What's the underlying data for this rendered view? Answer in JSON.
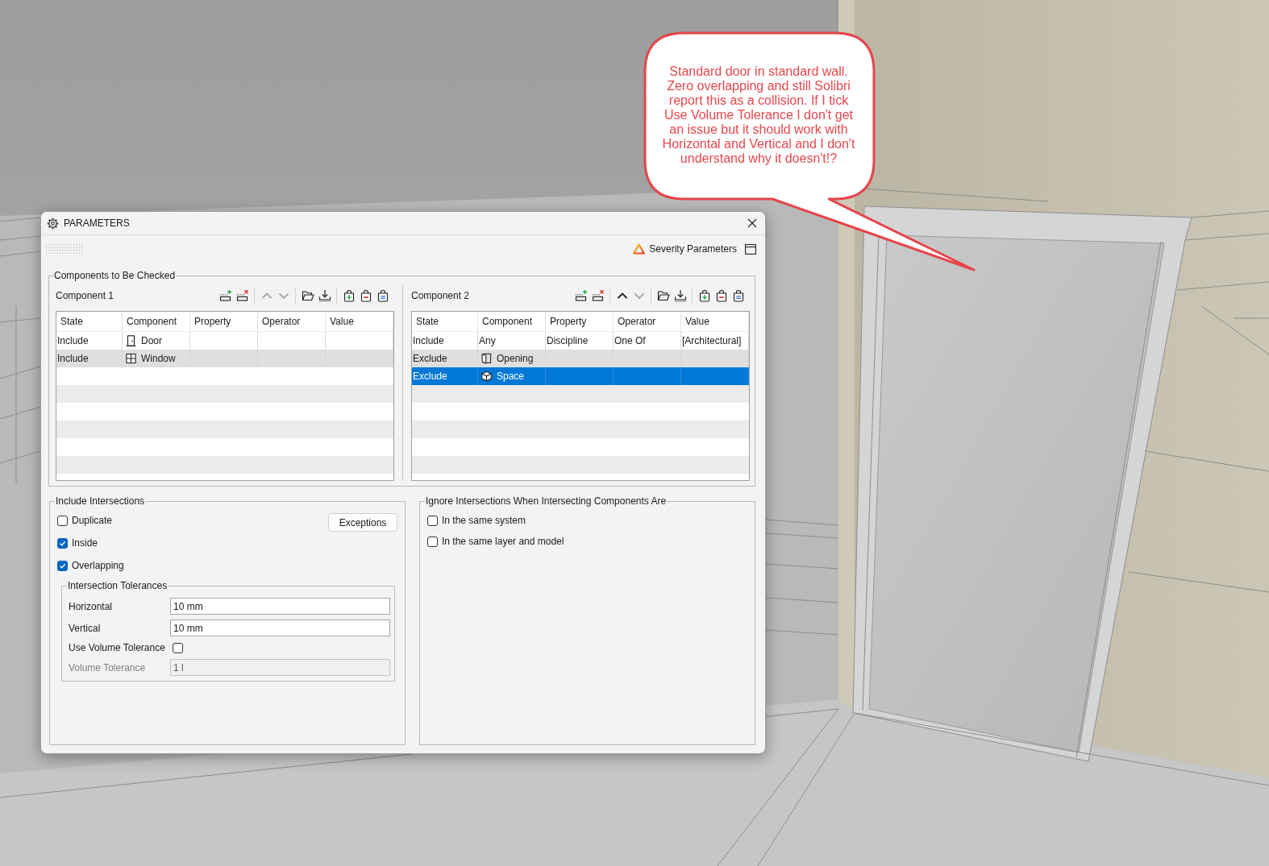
{
  "window": {
    "title": "PARAMETERS"
  },
  "header": {
    "severity_button": "Severity Parameters"
  },
  "components_group": {
    "title": "Components to Be Checked",
    "panels": [
      {
        "title": "Component 1",
        "toolbar": [
          [
            {
              "kind": "add_row",
              "disabled": false
            },
            {
              "kind": "remove_row",
              "disabled": false
            }
          ],
          [
            {
              "kind": "move_up",
              "disabled": true
            },
            {
              "kind": "move_down",
              "disabled": true
            }
          ],
          [
            {
              "kind": "open",
              "disabled": false
            },
            {
              "kind": "import",
              "disabled": false
            }
          ],
          [
            {
              "kind": "bag_add",
              "disabled": false
            },
            {
              "kind": "bag_remove",
              "disabled": false
            },
            {
              "kind": "bag_edit",
              "disabled": false
            }
          ]
        ],
        "table": {
          "columns": [
            "State",
            "Component",
            "Property",
            "Operator",
            "Value"
          ],
          "rows": [
            {
              "kind": "door",
              "selected": false,
              "state": "Include",
              "component": "Door"
            },
            {
              "kind": "window",
              "selected": false,
              "state": "Include",
              "component": "Window"
            }
          ]
        }
      },
      {
        "title": "Component 2",
        "toolbar": [
          [
            {
              "kind": "add_row",
              "disabled": false
            },
            {
              "kind": "remove_row",
              "disabled": false
            }
          ],
          [
            {
              "kind": "move_up",
              "disabled": false
            },
            {
              "kind": "move_down",
              "disabled": true
            }
          ],
          [
            {
              "kind": "open",
              "disabled": false
            },
            {
              "kind": "import",
              "disabled": false
            }
          ],
          [
            {
              "kind": "bag_add",
              "disabled": false
            },
            {
              "kind": "bag_remove",
              "disabled": false
            },
            {
              "kind": "bag_edit",
              "disabled": false
            }
          ]
        ],
        "table": {
          "columns": [
            "State",
            "Component",
            "Property",
            "Operator",
            "Value"
          ],
          "rows": [
            {
              "kind": "plain",
              "selected": false,
              "state": "Include",
              "component": "Any",
              "property": "Discipline",
              "operator": "One Of",
              "value": "[Architectural]"
            },
            {
              "kind": "opening",
              "selected": false,
              "state": "Exclude",
              "component": "Opening"
            },
            {
              "kind": "space",
              "selected": true,
              "state": "Exclude",
              "component": "Space"
            }
          ]
        }
      }
    ]
  },
  "include_intersections": {
    "title": "Include Intersections",
    "options": [
      {
        "label": "Duplicate",
        "checked": false
      },
      {
        "label": "Inside",
        "checked": true
      },
      {
        "label": "Overlapping",
        "checked": true
      }
    ],
    "exceptions_button": "Exceptions",
    "tolerances": {
      "title": "Intersection Tolerances",
      "fields": [
        {
          "kind": "text",
          "label": "Horizontal",
          "value": "10 mm",
          "disabled": false
        },
        {
          "kind": "text",
          "label": "Vertical",
          "value": "10 mm",
          "disabled": false
        },
        {
          "kind": "checkbox",
          "label": "Use Volume Tolerance",
          "checked": false
        },
        {
          "kind": "text",
          "label": "Volume Tolerance",
          "value": "1 l",
          "disabled": true
        }
      ]
    }
  },
  "ignore_intersections": {
    "title": "Ignore Intersections When Intersecting Components Are",
    "options": [
      {
        "label": "In the same system",
        "checked": false
      },
      {
        "label": "In the same layer and model",
        "checked": false
      }
    ]
  },
  "callout": {
    "text": "Standard door in standard wall. Zero overlapping and still Solibri report this as a collision. If I tick Use Volume Tolerance I don't get an issue but it should work with Horizontal and Vertical and I don't understand why it doesn't!?"
  }
}
